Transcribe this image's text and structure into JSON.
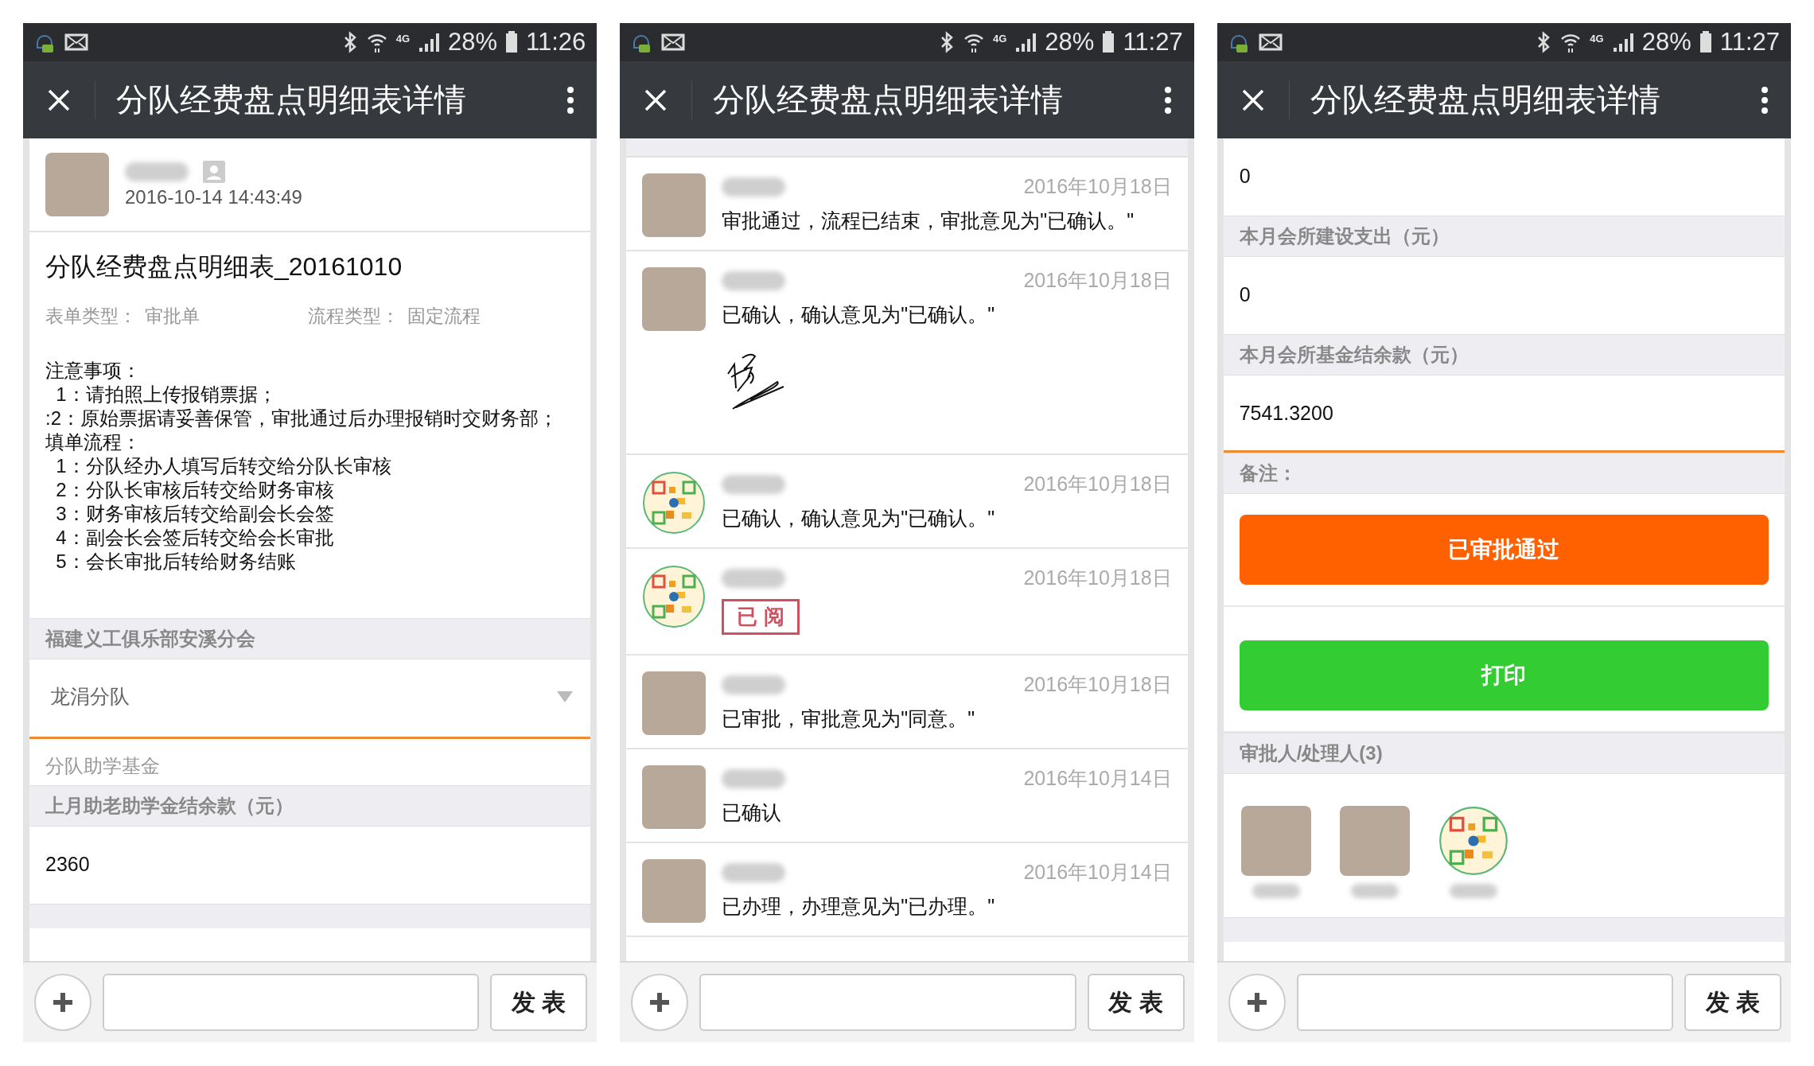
{
  "panels": [
    {
      "status_bar": {
        "network": "4G",
        "battery": "28%",
        "time": "11:26"
      },
      "title": "分队经费盘点明细表详情",
      "author": {
        "avatar": {
          "kind": "photo"
        },
        "time": "2016-10-14 14:43:49"
      },
      "form_title": "分队经费盘点明细表_20161010",
      "meta": [
        {
          "label": "表单类型：",
          "value": "审批单"
        },
        {
          "label": "流程类型：",
          "value": "固定流程"
        }
      ],
      "notes": [
        "注意事项：",
        "  1：请拍照上传报销票据；",
        ":2：原始票据请妥善保管，审批通过后办理报销时交财务部；",
        "填单流程：",
        "  1：分队经办人填写后转交给分队长审核",
        "  2：分队长审核后转交给财务审核",
        "  3：财务审核后转交给副会长会签",
        "  4：副会长会签后转交给会长审批",
        "  5：会长审批后转给财务结账"
      ],
      "fields": [
        {
          "kind": "header",
          "text": "福建义工俱乐部安溪分会"
        },
        {
          "kind": "select",
          "text": "龙涓分队",
          "focused": true
        },
        {
          "kind": "hint",
          "text": "分队助学基金"
        },
        {
          "kind": "header",
          "text": "上月助老助学金结余款（元）"
        },
        {
          "kind": "value",
          "text": "2360",
          "focused": false
        },
        {
          "kind": "cut"
        }
      ],
      "send_button": "发 表"
    },
    {
      "status_bar": {
        "network": "4G",
        "battery": "28%",
        "time": "11:27"
      },
      "title": "分队经费盘点明细表详情",
      "comments": [
        {
          "avatar": {
            "kind": "photo"
          },
          "date": "2016年10月18日",
          "text": "审批通过，流程已结束，审批意见为\"已确认。\""
        },
        {
          "avatar": {
            "kind": "photo"
          },
          "date": "2016年10月18日",
          "text": "已确认，确认意见为\"已确认。\"",
          "attachment": {
            "kind": "signature"
          }
        },
        {
          "avatar": {
            "kind": "logo"
          },
          "date": "2016年10月18日",
          "text": "已确认，确认意见为\"已确认。\""
        },
        {
          "avatar": {
            "kind": "logo"
          },
          "date": "2016年10月18日",
          "attachment": {
            "kind": "stamp",
            "text": "已 阅"
          }
        },
        {
          "avatar": {
            "kind": "photo"
          },
          "date": "2016年10月18日",
          "text": "已审批，审批意见为\"同意。\""
        },
        {
          "avatar": {
            "kind": "photo"
          },
          "date": "2016年10月14日",
          "text": "已确认"
        },
        {
          "avatar": {
            "kind": "photo"
          },
          "date": "2016年10月14日",
          "text": "已办理，办理意见为\"已办理。\""
        }
      ],
      "send_button": "发 表"
    },
    {
      "status_bar": {
        "network": "4G",
        "battery": "28%",
        "time": "11:27"
      },
      "title": "分队经费盘点明细表详情",
      "fields": [
        {
          "kind": "value",
          "text": "0",
          "focused": false
        },
        {
          "kind": "header",
          "text": "本月会所建设支出（元）"
        },
        {
          "kind": "value",
          "text": "0",
          "focused": false
        },
        {
          "kind": "header",
          "text": "本月会所基金结余款（元）"
        },
        {
          "kind": "value",
          "text": "7541.3200",
          "focused": true
        },
        {
          "kind": "header",
          "text": "备注："
        },
        {
          "kind": "button",
          "text": "已审批通过",
          "color": "#ff6000"
        },
        {
          "kind": "button",
          "text": "打印",
          "color": "#33cc33"
        },
        {
          "kind": "header",
          "text": "审批人/处理人(3)"
        },
        {
          "kind": "approvers",
          "avatars": [
            {
              "kind": "photo"
            },
            {
              "kind": "photo"
            },
            {
              "kind": "logo"
            }
          ]
        },
        {
          "kind": "cut"
        }
      ],
      "send_button": "发 表"
    }
  ]
}
